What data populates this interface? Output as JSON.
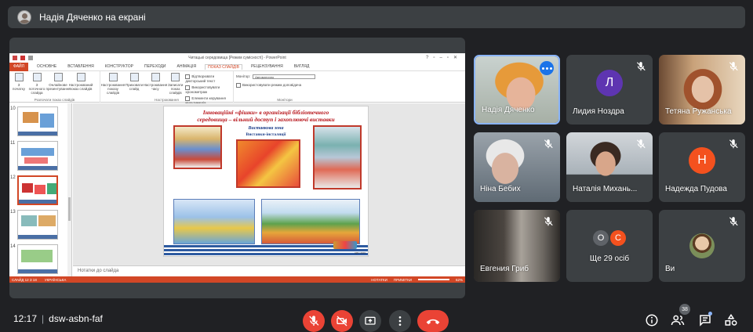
{
  "banner": {
    "text": "Надія Дяченко на екрані"
  },
  "ppt": {
    "window_title": "Читацькі середовища [Режим сумісності] - PowerPoint",
    "tabs": [
      {
        "label": "ФАЙЛ",
        "state": "file"
      },
      {
        "label": "ОСНОВНЕ",
        "state": ""
      },
      {
        "label": "ВСТАВЛЕННЯ",
        "state": ""
      },
      {
        "label": "КОНСТРУКТОР",
        "state": ""
      },
      {
        "label": "ПЕРЕХОДИ",
        "state": ""
      },
      {
        "label": "АНІМАЦІЯ",
        "state": ""
      },
      {
        "label": "ПОКАЗ СЛАЙДІВ",
        "state": "act"
      },
      {
        "label": "РЕЦЕНЗУВАННЯ",
        "state": ""
      },
      {
        "label": "ВИГЛЯД",
        "state": ""
      }
    ],
    "ribbon": {
      "start_group_label": "Розпочати показ слайдів",
      "setup_group_label": "Настроювання",
      "monitors_group_label": "Монітори",
      "btn_from_start": "З початку",
      "btn_from_current": "З поточного слайда",
      "btn_online": "Онлайнове презентування",
      "btn_custom": "Настроюваний показ слайдів",
      "btn_setup": "Настроювання показу слайдів",
      "btn_hide": "Приховати слайд",
      "btn_timings": "Настроювання часу",
      "btn_record": "Записати показ слайдів",
      "chk_narration": "Відтворювати дикторський текст",
      "chk_timings": "Використовувати хронометраж",
      "chk_media": "Елементи керування мультимедіа",
      "monitor_label": "Монітор:",
      "monitor_value": "Автоматично",
      "presenter_view": "Використовувати режим доповідача"
    },
    "thumb_numbers": [
      "10",
      "11",
      "12",
      "13",
      "14"
    ],
    "slide": {
      "title_line1": "Інноваційні «фішки» в організації бібліотечного",
      "title_line2": "середовища – вільний доступ і захоплюючі виставки",
      "subtitle1": "Виставкова зона",
      "subtitle2": "Виставки-інсталяції",
      "footer_note": "ЦБС 2019"
    },
    "notes_placeholder": "Нотатки до слайда",
    "status_left": "СЛАЙД 12 З 18",
    "status_lang": "УКРАЇНСЬКА",
    "status_notes": "НОТАТКИ",
    "status_comments": "ПРИМІТКИ",
    "zoom": "62%"
  },
  "participants": [
    {
      "name": "Надія Дяченко",
      "muted": false,
      "active": true
    },
    {
      "name": "Лидия Ноздра",
      "letter": "Л",
      "color": "#5e35b1",
      "muted": true
    },
    {
      "name": "Тетяна Ружанська",
      "muted": true
    },
    {
      "name": "Ніна Бебих",
      "muted": true
    },
    {
      "name": "Наталія Михань...",
      "muted": true
    },
    {
      "name": "Надежда Пудова",
      "letter": "Н",
      "color": "#f4511e",
      "muted": true
    },
    {
      "name": "Евгения Гриб",
      "muted": true
    },
    {
      "name": "Ще 29 осіб",
      "letters": [
        "О",
        "С"
      ],
      "letter_colors": [
        "#5f6368",
        "#f4511e"
      ]
    },
    {
      "name": "Ви",
      "muted": true
    }
  ],
  "bottom": {
    "time": "12:17",
    "meeting_code": "dsw-asbn-faf",
    "participants_count": "38"
  }
}
